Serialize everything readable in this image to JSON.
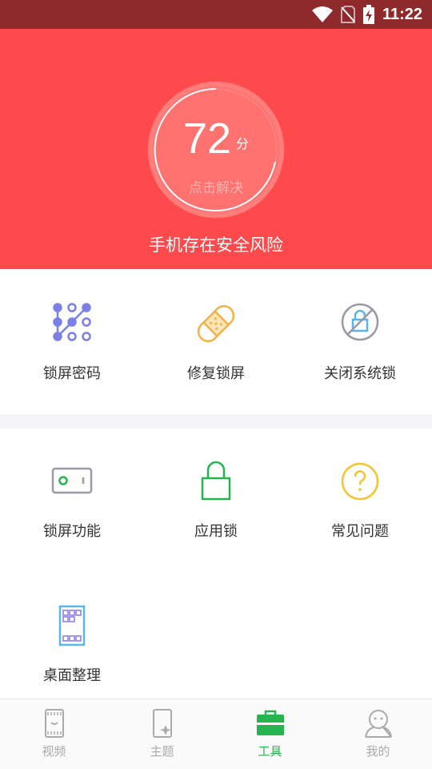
{
  "status_bar": {
    "time": "11:22"
  },
  "hero": {
    "score": "72",
    "score_unit": "分",
    "score_action": "点击解决",
    "warning": "手机存在安全风险",
    "bg_color": "#fe4a4c"
  },
  "tools": {
    "row1": [
      {
        "label": "锁屏密码",
        "icon": "pattern-lock-icon"
      },
      {
        "label": "修复锁屏",
        "icon": "bandage-icon"
      },
      {
        "label": "关闭系统锁",
        "icon": "lock-disabled-icon"
      }
    ],
    "row2": [
      {
        "label": "锁屏功能",
        "icon": "toggle-switch-icon"
      },
      {
        "label": "应用锁",
        "icon": "padlock-icon"
      },
      {
        "label": "常见问题",
        "icon": "question-icon"
      }
    ],
    "row3": [
      {
        "label": "桌面整理",
        "icon": "desktop-grid-icon"
      }
    ]
  },
  "tabbar": {
    "tabs": [
      {
        "label": "视频",
        "icon": "video-icon",
        "active": false
      },
      {
        "label": "主题",
        "icon": "theme-icon",
        "active": false
      },
      {
        "label": "工具",
        "icon": "toolbox-icon",
        "active": true
      },
      {
        "label": "我的",
        "icon": "profile-icon",
        "active": false
      }
    ],
    "active_color": "#27b34f",
    "inactive_color": "#aaaaaa"
  }
}
